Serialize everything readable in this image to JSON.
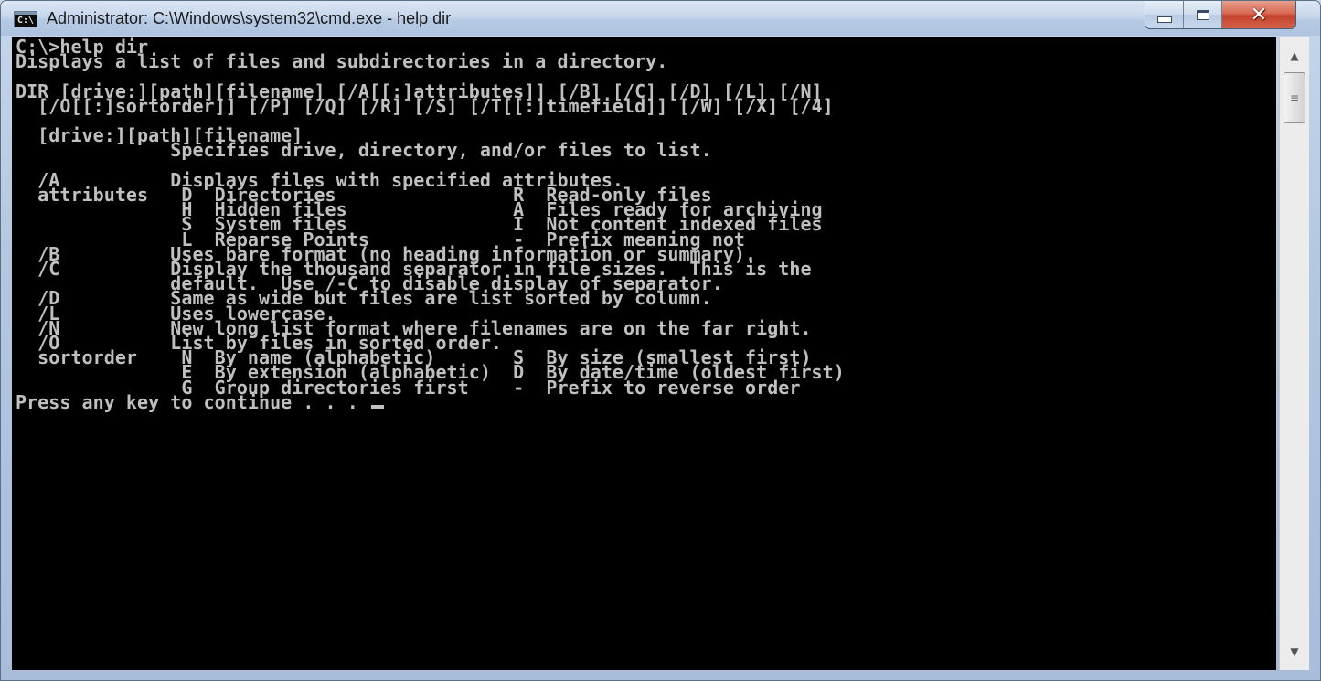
{
  "window": {
    "title": "Administrator: C:\\Windows\\system32\\cmd.exe - help  dir",
    "icon_label": "C:\\",
    "icon": "cmd-prompt-icon",
    "buttons": {
      "minimize": "minimize-icon",
      "maximize": "maximize-icon",
      "close": "close-icon"
    }
  },
  "console": {
    "lines": [
      "C:\\>help dir",
      "Displays a list of files and subdirectories in a directory.",
      "",
      "DIR [drive:][path][filename] [/A[[:]attributes]] [/B] [/C] [/D] [/L] [/N]",
      "  [/O[[:]sortorder]] [/P] [/Q] [/R] [/S] [/T[[:]timefield]] [/W] [/X] [/4]",
      "",
      "  [drive:][path][filename]",
      "              Specifies drive, directory, and/or files to list.",
      "",
      "  /A          Displays files with specified attributes.",
      "  attributes   D  Directories                R  Read-only files",
      "               H  Hidden files               A  Files ready for archiving",
      "               S  System files               I  Not content indexed files",
      "               L  Reparse Points             -  Prefix meaning not",
      "  /B          Uses bare format (no heading information or summary).",
      "  /C          Display the thousand separator in file sizes.  This is the",
      "              default.  Use /-C to disable display of separator.",
      "  /D          Same as wide but files are list sorted by column.",
      "  /L          Uses lowercase.",
      "  /N          New long list format where filenames are on the far right.",
      "  /O          List by files in sorted order.",
      "  sortorder    N  By name (alphabetic)       S  By size (smallest first)",
      "               E  By extension (alphabetic)  D  By date/time (oldest first)",
      "               G  Group directories first    -  Prefix to reverse order"
    ],
    "prompt_line": "Press any key to continue . . . "
  },
  "colors": {
    "console_bg": "#000000",
    "console_fg": "#c0c0c0",
    "close_button": "#c4422c"
  },
  "scrollbar": {
    "up_icon": "scroll-up-arrow-icon",
    "down_icon": "scroll-down-arrow-icon",
    "thumb_icon": "grip-icon"
  }
}
